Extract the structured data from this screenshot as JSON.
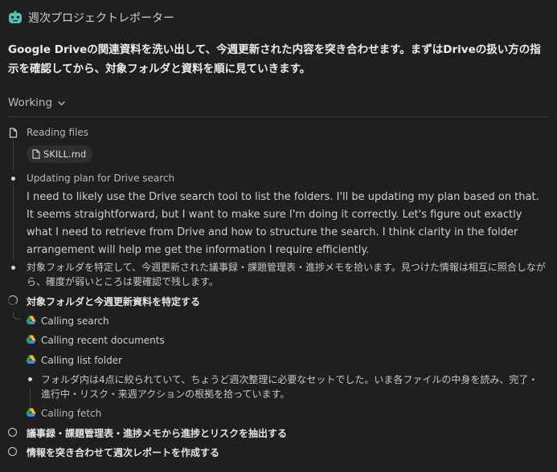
{
  "header": {
    "title": "週次プロジェクトレポーター",
    "icon": "robot-icon"
  },
  "intro": "Google Driveの関連資料を洗い出して、今週更新された内容を突き合わせます。まずはDriveの扱い方の指示を確認してから、対象フォルダと資料を順に見ていきます。",
  "status": {
    "label": "Working"
  },
  "steps": {
    "reading": {
      "label": "Reading files",
      "file": "SKILL.md"
    },
    "updating": {
      "label": "Updating plan for Drive search",
      "body": "I need to likely use the Drive search tool to list the folders. I'll be updating my plan based on that. It seems straightforward, but I want to make sure I'm doing it correctly. Let's figure out exactly what I need to retrieve from Drive and how to structure the search. I think clarity in the folder arrangement will help me get the information I require efficiently."
    },
    "note1": "対象フォルダを特定して、今週更新された議事録・課題管理表・進捗メモを拾います。見つけた情報は相互に照合しながら、確度が弱いところは要確認で残します。",
    "task1": {
      "label": "対象フォルダと今週更新資料を特定する",
      "calls": [
        "Calling search",
        "Calling recent documents",
        "Calling list folder"
      ],
      "note": "フォルダ内は4点に絞られていて、ちょうど週次整理に必要なセットでした。いま各ファイルの中身を読み、完了・進行中・リスク・来週アクションの根拠を拾っています。",
      "fetch": "Calling fetch"
    },
    "task2": "議事録・課題管理表・進捗メモから進捗とリスクを抽出する",
    "task3": "情報を突き合わせて週次レポートを作成する"
  },
  "colors": {
    "background": "#1f1f1f",
    "app_icon": "#4fc3b5",
    "drive_green": "#1fa463",
    "drive_yellow": "#ffc107",
    "drive_blue": "#4285f4"
  }
}
